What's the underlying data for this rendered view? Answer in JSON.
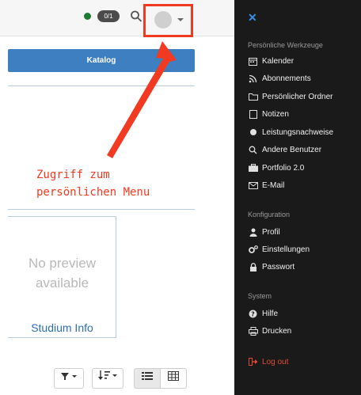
{
  "header": {
    "notification_count": "0/1",
    "status_color": "#1f7a33",
    "highlight_color": "#f23a22"
  },
  "main": {
    "catalog_button": "Katalog",
    "annotation_line1": "Zugriff zum",
    "annotation_line2": "persönlichen Menu",
    "card": {
      "preview_line1": "No preview",
      "preview_line2": "available",
      "link": "Studium Info"
    }
  },
  "sidebar": {
    "close_icon": "close-icon",
    "personal_tools_title": "Persönliche Werkzeuge",
    "personal_tools": [
      {
        "label": "Kalender",
        "icon": "calendar-icon"
      },
      {
        "label": "Abonnements",
        "icon": "rss-icon"
      },
      {
        "label": "Persönlicher Ordner",
        "icon": "folder-icon"
      },
      {
        "label": "Notizen",
        "icon": "note-icon"
      },
      {
        "label": "Leistungsnachweise",
        "icon": "certificate-icon"
      },
      {
        "label": "Andere Benutzer",
        "icon": "search-icon"
      },
      {
        "label": "Portfolio 2.0",
        "icon": "portfolio-icon"
      },
      {
        "label": "E-Mail",
        "icon": "mail-icon"
      }
    ],
    "config_title": "Konfiguration",
    "config": [
      {
        "label": "Profil",
        "icon": "user-icon"
      },
      {
        "label": "Einstellungen",
        "icon": "gears-icon"
      },
      {
        "label": "Passwort",
        "icon": "lock-icon"
      }
    ],
    "system_title": "System",
    "system": [
      {
        "label": "Hilfe",
        "icon": "help-icon"
      },
      {
        "label": "Drucken",
        "icon": "print-icon"
      }
    ],
    "logout": "Log out",
    "logout_color": "#e24a36"
  }
}
